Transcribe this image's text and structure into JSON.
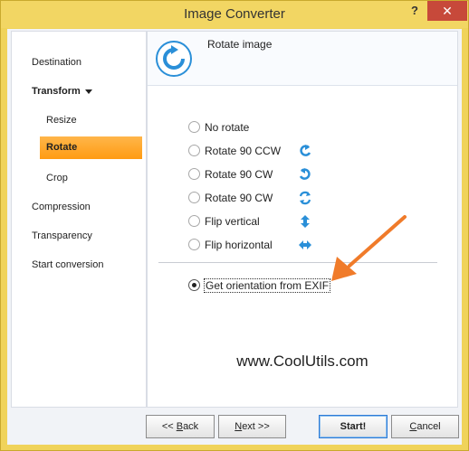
{
  "window": {
    "title": "Image Converter",
    "help_label": "?",
    "close_label": "✕"
  },
  "sidebar": {
    "items": [
      {
        "label": "Destination"
      },
      {
        "label": "Transform"
      },
      {
        "label": "Resize"
      },
      {
        "label": "Rotate"
      },
      {
        "label": "Crop"
      },
      {
        "label": "Compression"
      },
      {
        "label": "Transparency"
      },
      {
        "label": "Start conversion"
      }
    ],
    "active": "Rotate"
  },
  "main": {
    "title": "Rotate image",
    "options": [
      {
        "label": "No rotate",
        "checked": false,
        "icon": null
      },
      {
        "label": "Rotate 90 CCW",
        "checked": false,
        "icon": "rotate-ccw-icon"
      },
      {
        "label": "Rotate 90 CW",
        "checked": false,
        "icon": "rotate-cw-icon"
      },
      {
        "label": "Rotate 90 CW",
        "checked": false,
        "icon": "rotate-cw-double-icon"
      },
      {
        "label": "Flip vertical",
        "checked": false,
        "icon": "flip-vertical-icon"
      },
      {
        "label": "Flip horizontal",
        "checked": false,
        "icon": "flip-horizontal-icon"
      }
    ],
    "exif_option": {
      "label": "Get orientation from EXIF",
      "checked": true
    },
    "watermark": "www.CoolUtils.com"
  },
  "buttons": {
    "back": {
      "prefix": "<< ",
      "mnemonic": "B",
      "rest": "ack"
    },
    "next": {
      "prefix": "",
      "mnemonic": "N",
      "rest": "ext >>"
    },
    "start": "Start!",
    "cancel": {
      "prefix": "",
      "mnemonic": "C",
      "rest": "ancel"
    }
  },
  "colors": {
    "accent": "#ff9b12",
    "title_bar": "#f2d663",
    "close": "#c7493a",
    "arrow": "#f07b2a",
    "icon_blue": "#2a8fd8"
  }
}
